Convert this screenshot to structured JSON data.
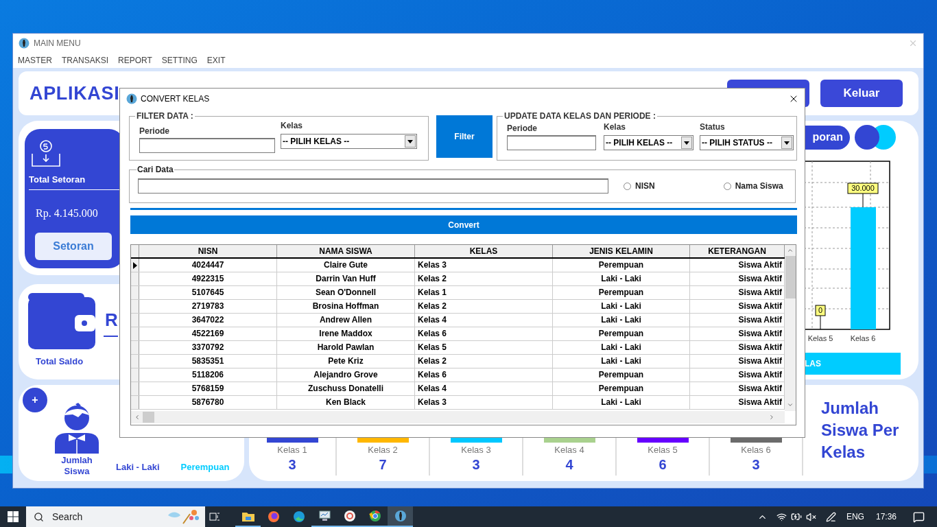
{
  "main_window": {
    "title": "MAIN MENU",
    "menu": [
      "MASTER",
      "TRANSAKSI",
      "REPORT",
      "SETTING",
      "EXIT"
    ]
  },
  "header": {
    "title": "APLIKASI",
    "exit_button": "Keluar"
  },
  "setoran_card": {
    "label": "Total Setoran",
    "amount": "Rp. 4.145.000",
    "button": "Setoran"
  },
  "saldo_card": {
    "label": "Total Saldo",
    "amount": "R"
  },
  "chart_panel": {
    "report_button": "poran",
    "chart_data": {
      "type": "bar",
      "categories": [
        "Kelas 5",
        "Kelas 6"
      ],
      "values": [
        0,
        30000
      ],
      "value_labels": [
        "0",
        "30.000"
      ]
    },
    "footer_button": "LAS"
  },
  "siswa_card": {
    "add_button": "+",
    "label": "Jumlah Siswa",
    "male": "Laki - Laki",
    "female": "Perempuan"
  },
  "kelas_counts": [
    {
      "label": "Kelas 1",
      "count": "3",
      "color": "#3346d3"
    },
    {
      "label": "Kelas 2",
      "count": "7",
      "color": "#ffb700"
    },
    {
      "label": "Kelas 3",
      "count": "3",
      "color": "#00c8ff"
    },
    {
      "label": "Kelas 4",
      "count": "4",
      "color": "#a9d18e"
    },
    {
      "label": "Kelas 5",
      "count": "6",
      "color": "#6600ff"
    },
    {
      "label": "Kelas 6",
      "count": "3",
      "color": "#6b6b6b"
    }
  ],
  "kelas_title": "Jumlah Siswa Per Kelas",
  "dialog": {
    "title": "CONVERT KELAS",
    "filter": {
      "legend": "FILTER DATA :",
      "periode_label": "Periode",
      "kelas_label": "Kelas",
      "kelas_value": "-- PILIH KELAS --"
    },
    "filter_button": "Filter",
    "update": {
      "legend": "UPDATE DATA KELAS DAN PERIODE :",
      "periode_label": "Periode",
      "kelas_label": "Kelas",
      "kelas_value": "-- PILIH KELAS --",
      "status_label": "Status",
      "status_value": "-- PILIH STATUS --"
    },
    "search": {
      "legend": "Cari Data",
      "options": [
        {
          "label": "NISN",
          "selected": false
        },
        {
          "label": "Nama Siswa",
          "selected": false
        }
      ]
    },
    "convert_button": "Convert",
    "table": {
      "columns": [
        "NISN",
        "NAMA SISWA",
        "KELAS",
        "JENIS KELAMIN",
        "KETERANGAN"
      ],
      "rows": [
        {
          "selected": true,
          "cells": [
            "4024447",
            "Claire Gute",
            "Kelas 3",
            "Perempuan",
            "Siswa Aktif"
          ]
        },
        {
          "selected": false,
          "cells": [
            "4922315",
            "Darrin Van Huff",
            "Kelas 2",
            "Laki - Laki",
            "Siswa Aktif"
          ]
        },
        {
          "selected": false,
          "cells": [
            "5107645",
            "Sean O'Donnell",
            "Kelas 1",
            "Perempuan",
            "Siswa Aktif"
          ]
        },
        {
          "selected": false,
          "cells": [
            "2719783",
            "Brosina Hoffman",
            "Kelas 2",
            "Laki - Laki",
            "Siswa Aktif"
          ]
        },
        {
          "selected": false,
          "cells": [
            "3647022",
            "Andrew Allen",
            "Kelas 4",
            "Laki - Laki",
            "Siswa Aktif"
          ]
        },
        {
          "selected": false,
          "cells": [
            "4522169",
            "Irene Maddox",
            "Kelas 6",
            "Perempuan",
            "Siswa Aktif"
          ]
        },
        {
          "selected": false,
          "cells": [
            "3370792",
            "Harold Pawlan",
            "Kelas 5",
            "Laki - Laki",
            "Siswa Aktif"
          ]
        },
        {
          "selected": false,
          "cells": [
            "5835351",
            "Pete Kriz",
            "Kelas 2",
            "Laki - Laki",
            "Siswa Aktif"
          ]
        },
        {
          "selected": false,
          "cells": [
            "5118206",
            "Alejandro Grove",
            "Kelas 6",
            "Perempuan",
            "Siswa Aktif"
          ]
        },
        {
          "selected": false,
          "cells": [
            "5768159",
            "Zuschuss Donatelli",
            "Kelas 4",
            "Perempuan",
            "Siswa Aktif"
          ]
        },
        {
          "selected": false,
          "cells": [
            "5876780",
            "Ken Black",
            "Kelas 3",
            "Laki - Laki",
            "Siswa Aktif"
          ]
        }
      ]
    }
  },
  "taskbar": {
    "search": "Search",
    "language": "ENG",
    "time": "17:36"
  }
}
